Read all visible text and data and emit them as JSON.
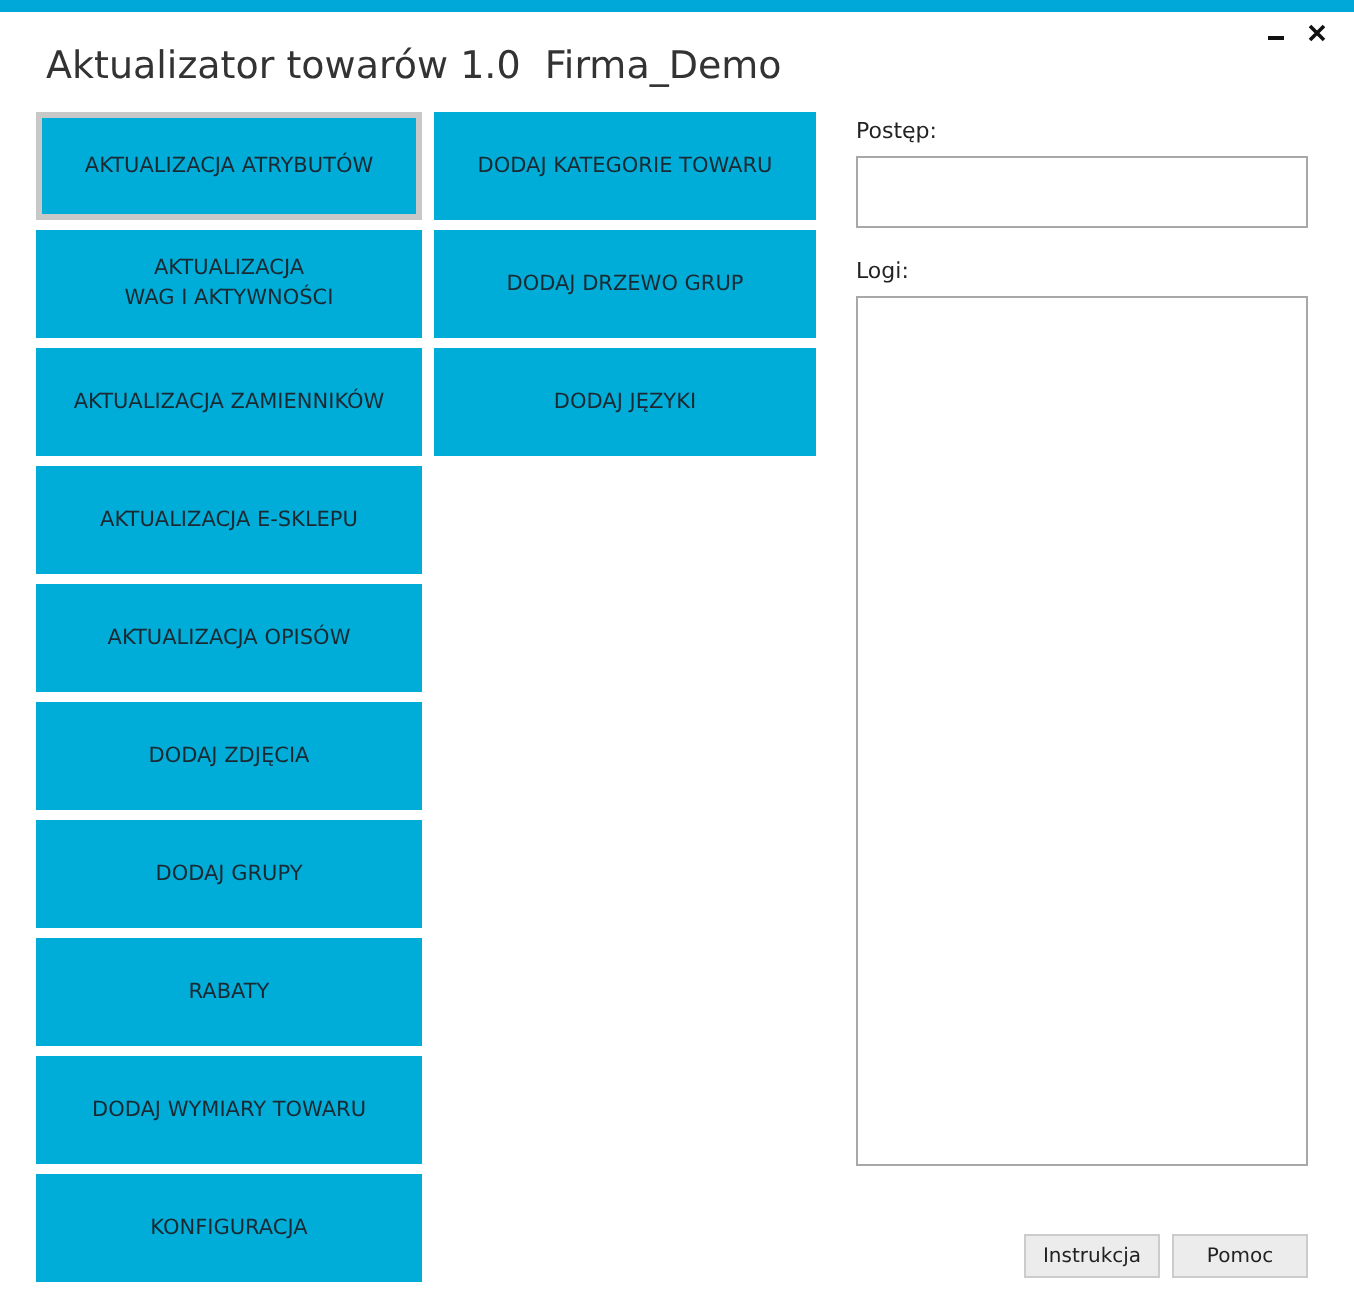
{
  "window": {
    "title": "Aktualizator towarów 1.0  Firma_Demo",
    "controls": [
      {
        "kind": "minimize"
      },
      {
        "kind": "close"
      }
    ]
  },
  "columns": [
    [
      {
        "label": "AKTUALIZACJA ATRYBUTÓW",
        "selected": true
      },
      {
        "label": "AKTUALIZACJA\nWAG I AKTYWNOŚCI",
        "selected": false
      },
      {
        "label": "AKTUALIZACJA ZAMIENNIKÓW",
        "selected": false
      },
      {
        "label": "AKTUALIZACJA E-SKLEPU",
        "selected": false
      },
      {
        "label": "AKTUALIZACJA OPISÓW",
        "selected": false
      },
      {
        "label": "DODAJ ZDJĘCIA",
        "selected": false
      },
      {
        "label": "DODAJ GRUPY",
        "selected": false
      },
      {
        "label": "RABATY",
        "selected": false
      },
      {
        "label": "DODAJ WYMIARY TOWARU",
        "selected": false
      },
      {
        "label": "KONFIGURACJA",
        "selected": false
      }
    ],
    [
      {
        "label": "DODAJ KATEGORIE TOWARU",
        "selected": false
      },
      {
        "label": "DODAJ DRZEWO GRUP",
        "selected": false
      },
      {
        "label": "DODAJ JĘZYKI",
        "selected": false
      }
    ]
  ],
  "progress": {
    "label": "Postęp:"
  },
  "logs": {
    "label": "Logi:"
  },
  "buttons": [
    "Instrukcja",
    "Pomoc"
  ]
}
